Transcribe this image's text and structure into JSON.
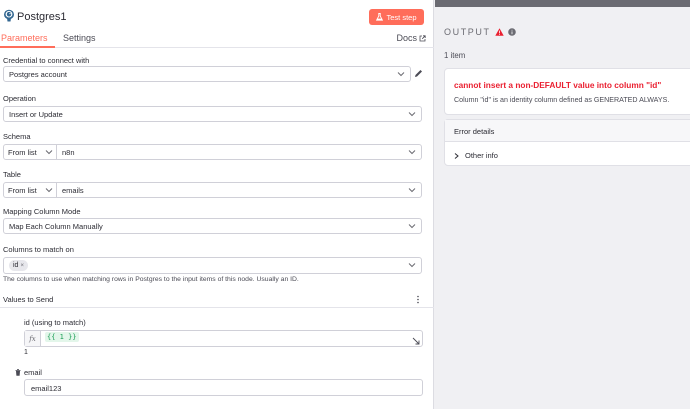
{
  "node": {
    "title": "Postgres1",
    "test_button": "Test step",
    "tabs": [
      "Parameters",
      "Settings"
    ],
    "docs_label": "Docs"
  },
  "fields": {
    "credential": {
      "label": "Credential to connect with",
      "value": "Postgres account"
    },
    "operation": {
      "label": "Operation",
      "value": "Insert or Update"
    },
    "schema": {
      "label": "Schema",
      "mode": "From list",
      "value": "n8n"
    },
    "table": {
      "label": "Table",
      "mode": "From list",
      "value": "emails"
    },
    "mapping": {
      "label": "Mapping Column Mode",
      "value": "Map Each Column Manually"
    },
    "match": {
      "label": "Columns to match on",
      "tag": "id",
      "hint": "The columns to use when matching rows in Postgres to the input items of this node. Usually an ID."
    }
  },
  "values": {
    "title": "Values to Send",
    "id_label": "id (using to match)",
    "id_fx": "fx",
    "id_expression": "{{ 1 }}",
    "id_result": "1",
    "email_label": "email",
    "email_value": "email123"
  },
  "output": {
    "title": "OUTPUT",
    "item_count": "1 item",
    "error_title": "cannot insert a non-DEFAULT value into column \"id\"",
    "error_description": "Column \"id\" is an identity column defined as GENERATED ALWAYS.",
    "details_title": "Error details",
    "other_info": "Other info"
  },
  "colors": {
    "accent": "#ff6d5a",
    "error": "#ea1f30",
    "expression_green": "#1e9e57"
  },
  "icons": [
    "postgres-icon",
    "flask-icon",
    "external-link-icon",
    "chevron-down-icon",
    "pencil-icon",
    "kebab-menu-icon",
    "expand-icon",
    "trash-icon",
    "warning-icon",
    "info-icon",
    "caret-right-icon"
  ]
}
